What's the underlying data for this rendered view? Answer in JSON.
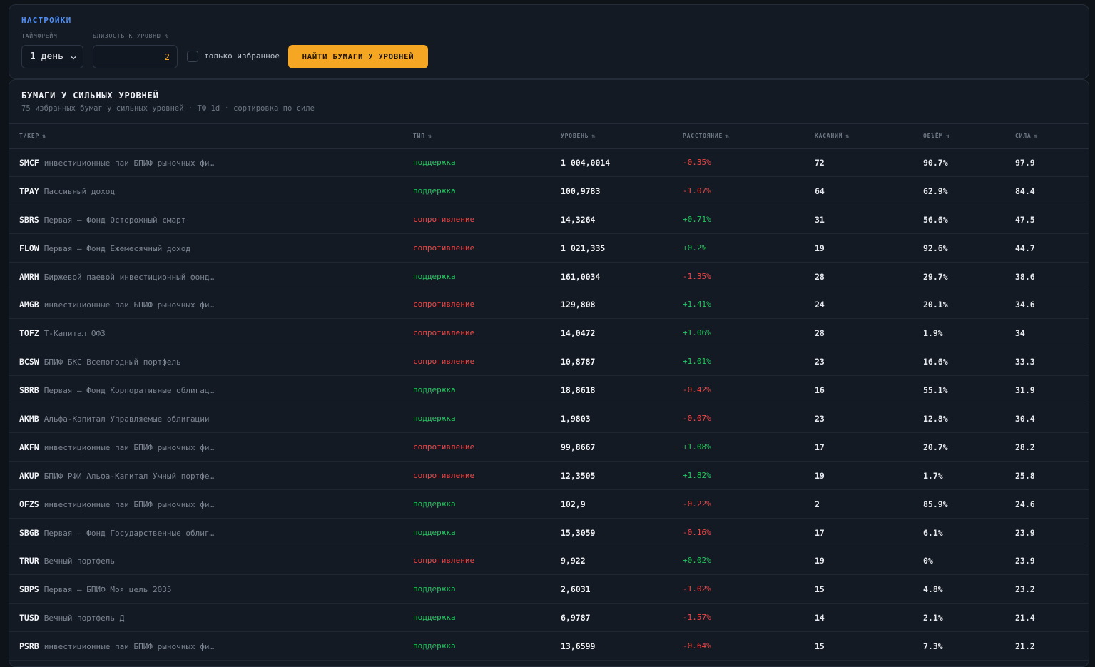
{
  "settings": {
    "title": "НАСТРОЙКИ",
    "timeframe_label": "ТАЙМФРЕЙМ",
    "timeframe_value": "1 день",
    "proximity_label": "БЛИЗОСТЬ К УРОВНЮ %",
    "proximity_value": "2",
    "favorites_only_label": "только избранное",
    "favorites_only_checked": false,
    "find_button": "НАЙТИ БУМАГИ У УРОВНЕЙ"
  },
  "results": {
    "title": "БУМАГИ У СИЛЬНЫХ УРОВНЕЙ",
    "subtitle": "75 избранных бумаг у сильных уровней · ТФ 1d · сортировка по силе",
    "columns": [
      "ТИКЕР",
      "ТИП",
      "УРОВЕНЬ",
      "РАССТОЯНИЕ",
      "КАСАНИЙ",
      "ОБЪЁМ",
      "СИЛА"
    ],
    "sort_icon": "⇅",
    "colors": {
      "support": "#22c55e",
      "resistance": "#ef4444",
      "accent": "#f5a623",
      "title": "#4f8ff7"
    },
    "rows": [
      {
        "ticker": "SMCF",
        "name": "инвестиционные паи БПИФ рыночных фи…",
        "type": "поддержка",
        "kind": "support",
        "level": "1 004,0014",
        "distance": "-0.35%",
        "touches": "72",
        "volume": "90.7%",
        "strength": "97.9"
      },
      {
        "ticker": "TPAY",
        "name": "Пассивный доход",
        "type": "поддержка",
        "kind": "support",
        "level": "100,9783",
        "distance": "-1.07%",
        "touches": "64",
        "volume": "62.9%",
        "strength": "84.4"
      },
      {
        "ticker": "SBRS",
        "name": "Первая – Фонд Осторожный смарт",
        "type": "сопротивление",
        "kind": "resistance",
        "level": "14,3264",
        "distance": "+0.71%",
        "touches": "31",
        "volume": "56.6%",
        "strength": "47.5"
      },
      {
        "ticker": "FLOW",
        "name": "Первая – Фонд Ежемесячный доход",
        "type": "сопротивление",
        "kind": "resistance",
        "level": "1 021,335",
        "distance": "+0.2%",
        "touches": "19",
        "volume": "92.6%",
        "strength": "44.7"
      },
      {
        "ticker": "AMRH",
        "name": "Биржевой паевой инвестиционный фонд…",
        "type": "поддержка",
        "kind": "support",
        "level": "161,0034",
        "distance": "-1.35%",
        "touches": "28",
        "volume": "29.7%",
        "strength": "38.6"
      },
      {
        "ticker": "AMGB",
        "name": "инвестиционные паи БПИФ рыночных фи…",
        "type": "сопротивление",
        "kind": "resistance",
        "level": "129,808",
        "distance": "+1.41%",
        "touches": "24",
        "volume": "20.1%",
        "strength": "34.6"
      },
      {
        "ticker": "TOFZ",
        "name": "Т-Капитал ОФЗ",
        "type": "сопротивление",
        "kind": "resistance",
        "level": "14,0472",
        "distance": "+1.06%",
        "touches": "28",
        "volume": "1.9%",
        "strength": "34"
      },
      {
        "ticker": "BCSW",
        "name": "БПИФ БКС Всепогодный портфель",
        "type": "сопротивление",
        "kind": "resistance",
        "level": "10,8787",
        "distance": "+1.01%",
        "touches": "23",
        "volume": "16.6%",
        "strength": "33.3"
      },
      {
        "ticker": "SBRB",
        "name": "Первая – Фонд Корпоративные облигац…",
        "type": "поддержка",
        "kind": "support",
        "level": "18,8618",
        "distance": "-0.42%",
        "touches": "16",
        "volume": "55.1%",
        "strength": "31.9"
      },
      {
        "ticker": "AKMB",
        "name": "Альфа-Капитал Управляемые облигации",
        "type": "поддержка",
        "kind": "support",
        "level": "1,9803",
        "distance": "-0.07%",
        "touches": "23",
        "volume": "12.8%",
        "strength": "30.4"
      },
      {
        "ticker": "AKFN",
        "name": "инвестиционные паи БПИФ рыночных фи…",
        "type": "сопротивление",
        "kind": "resistance",
        "level": "99,8667",
        "distance": "+1.08%",
        "touches": "17",
        "volume": "20.7%",
        "strength": "28.2"
      },
      {
        "ticker": "AKUP",
        "name": "БПИФ РФИ Альфа-Капитал Умный портфе…",
        "type": "сопротивление",
        "kind": "resistance",
        "level": "12,3505",
        "distance": "+1.82%",
        "touches": "19",
        "volume": "1.7%",
        "strength": "25.8"
      },
      {
        "ticker": "OFZS",
        "name": "инвестиционные паи БПИФ рыночных фи…",
        "type": "поддержка",
        "kind": "support",
        "level": "102,9",
        "distance": "-0.22%",
        "touches": "2",
        "volume": "85.9%",
        "strength": "24.6"
      },
      {
        "ticker": "SBGB",
        "name": "Первая – Фонд Государственные облиг…",
        "type": "поддержка",
        "kind": "support",
        "level": "15,3059",
        "distance": "-0.16%",
        "touches": "17",
        "volume": "6.1%",
        "strength": "23.9"
      },
      {
        "ticker": "TRUR",
        "name": "Вечный портфель",
        "type": "сопротивление",
        "kind": "resistance",
        "level": "9,922",
        "distance": "+0.02%",
        "touches": "19",
        "volume": "0%",
        "strength": "23.9"
      },
      {
        "ticker": "SBPS",
        "name": "Первая – БПИФ Моя цель 2035",
        "type": "поддержка",
        "kind": "support",
        "level": "2,6031",
        "distance": "-1.02%",
        "touches": "15",
        "volume": "4.8%",
        "strength": "23.2"
      },
      {
        "ticker": "TUSD",
        "name": "Вечный портфель Д",
        "type": "поддержка",
        "kind": "support",
        "level": "6,9787",
        "distance": "-1.57%",
        "touches": "14",
        "volume": "2.1%",
        "strength": "21.4"
      },
      {
        "ticker": "PSRB",
        "name": "инвестиционные паи БПИФ рыночных фи…",
        "type": "поддержка",
        "kind": "support",
        "level": "13,6599",
        "distance": "-0.64%",
        "touches": "15",
        "volume": "7.3%",
        "strength": "21.2"
      }
    ]
  }
}
